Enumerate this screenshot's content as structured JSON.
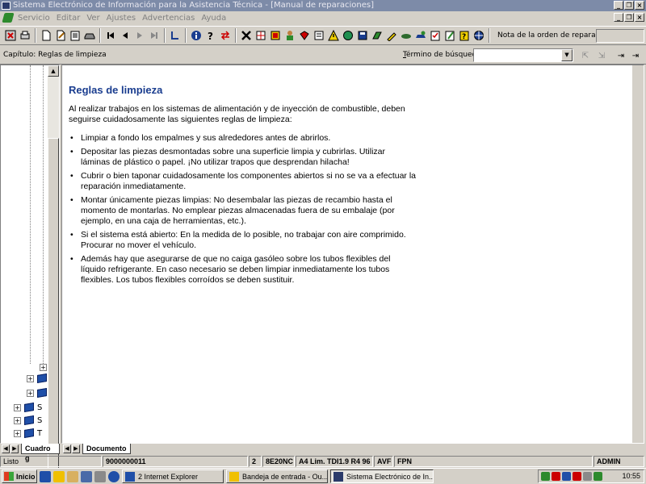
{
  "window": {
    "title": "Sistema Electrónico de Información para la Asistencia Técnica - [Manual de reparaciones]",
    "minimize_glyph": "_",
    "restore_glyph": "❐",
    "close_glyph": "×"
  },
  "menu": {
    "items": [
      "Servicio",
      "Editar",
      "Ver",
      "Ajustes",
      "Advertencias",
      "Ayuda"
    ]
  },
  "toolbar": {
    "nota_label": "Nota de la orden de reparación:",
    "nota_value": ""
  },
  "chapter_bar": {
    "chapter_label": "Capítulo: Reglas de limpieza",
    "search_label_prefix": "T",
    "search_label_rest": "érmino de búsqueda:",
    "search_value": ""
  },
  "tree": {
    "items": [
      {
        "label": "",
        "expander": "+"
      },
      {
        "label": "",
        "expander": "+"
      },
      {
        "label": "",
        "expander": "+"
      },
      {
        "label": "S",
        "expander": "+"
      },
      {
        "label": "S",
        "expander": "+"
      },
      {
        "label": "T",
        "expander": "+"
      }
    ]
  },
  "document": {
    "title": "Reglas de limpieza",
    "intro": "Al realizar trabajos en los sistemas de alimentación y de inyección de combustible, deben seguirse cuidadosamente las siguientes reglas de limpieza:",
    "rules": [
      "Limpiar a fondo los empalmes y sus alrededores antes de abrirlos.",
      "Depositar las piezas desmontadas sobre una superficie limpia y cubrirlas. Utilizar láminas de plástico o papel. ¡No utilizar trapos que desprendan hilacha!",
      "Cubrir o bien taponar cuidadosamente los componentes abiertos si no se va a efectuar la reparación inmediatamente.",
      "Montar únicamente piezas limpias: No desembalar las piezas de recambio hasta el momento de montarlas. No emplear piezas almacenadas fuera de su embalaje (por ejemplo, en una caja de herramientas, etc.).",
      "Si el sistema está abierto: En la medida de lo posible, no trabajar con aire comprimido. Procurar no mover el vehículo.",
      "Además hay que asegurarse de que no caiga gasóleo sobre los tubos flexibles del líquido refrigerante. En caso necesario se deben limpiar inmediatamente los tubos flexibles. Los tubos flexibles corroídos se deben sustituir."
    ]
  },
  "tabs": {
    "left_tab": "Cuadro g",
    "right_tab": "Documento"
  },
  "status": {
    "state": "Listo",
    "number": "9000000011",
    "field_a": "2",
    "field_b": "8E20NC",
    "vehicle": "A4 Lim. TDI1.9 R4 96",
    "field_c": "AVF",
    "field_d": "FPN",
    "user": "ADMIN"
  },
  "taskbar": {
    "start_label": "Inicio",
    "tasks": [
      {
        "label": "2 Internet Explorer",
        "active": false
      },
      {
        "label": "Bandeja de entrada - Ou...",
        "active": false
      },
      {
        "label": "Sistema Electrónico de In...",
        "active": true
      }
    ],
    "clock": "10:55"
  },
  "colors": {
    "titlebar": "#7d8ba8",
    "heading": "#1a3d8f",
    "chrome": "#d4d0c8"
  }
}
